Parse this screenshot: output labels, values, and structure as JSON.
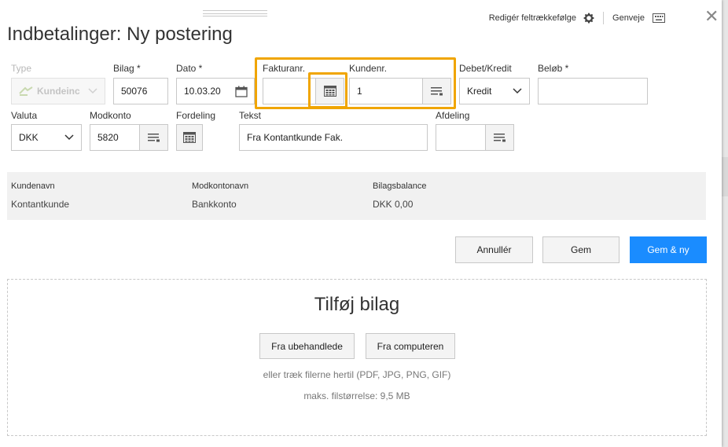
{
  "header": {
    "title": "Indbetalinger: Ny postering",
    "edit_field_order": "Redigér feltrækkefølge",
    "shortcuts": "Genveje",
    "close_glyph": "✕"
  },
  "form": {
    "type": {
      "label": "Type",
      "value": "Kundeinc",
      "icon": "customer-payment-icon"
    },
    "bilag": {
      "label": "Bilag *",
      "value": "50076"
    },
    "dato": {
      "label": "Dato *",
      "value": "10.03.20"
    },
    "fakturanr": {
      "label": "Fakturanr.",
      "value": ""
    },
    "kundenr": {
      "label": "Kundenr.",
      "value": "1"
    },
    "debet_kredit": {
      "label": "Debet/Kredit",
      "value": "Kredit"
    },
    "beloeb": {
      "label": "Beløb *",
      "value": ""
    },
    "valuta": {
      "label": "Valuta",
      "value": "DKK"
    },
    "modkonto": {
      "label": "Modkonto",
      "value": "5820"
    },
    "fordeling": {
      "label": "Fordeling"
    },
    "tekst": {
      "label": "Tekst",
      "value": "Fra Kontantkunde Fak."
    },
    "afdeling": {
      "label": "Afdeling",
      "value": ""
    }
  },
  "summary": {
    "kundenavn": {
      "label": "Kundenavn",
      "value": "Kontantkunde"
    },
    "modkontonavn": {
      "label": "Modkontonavn",
      "value": "Bankkonto"
    },
    "bilagsbalance": {
      "label": "Bilagsbalance",
      "value": "DKK 0,00"
    }
  },
  "actions": {
    "cancel": "Annullér",
    "save": "Gem",
    "save_new": "Gem & ny"
  },
  "attachments": {
    "title": "Tilføj bilag",
    "from_unprocessed": "Fra ubehandlede",
    "from_computer": "Fra computeren",
    "drag_hint": "eller træk filerne hertil (PDF, JPG, PNG, GIF)",
    "max_size": "maks. filstørrelse: 9,5 MB"
  },
  "colors": {
    "accent": "#1a8cff",
    "highlight": "#f0a500"
  }
}
